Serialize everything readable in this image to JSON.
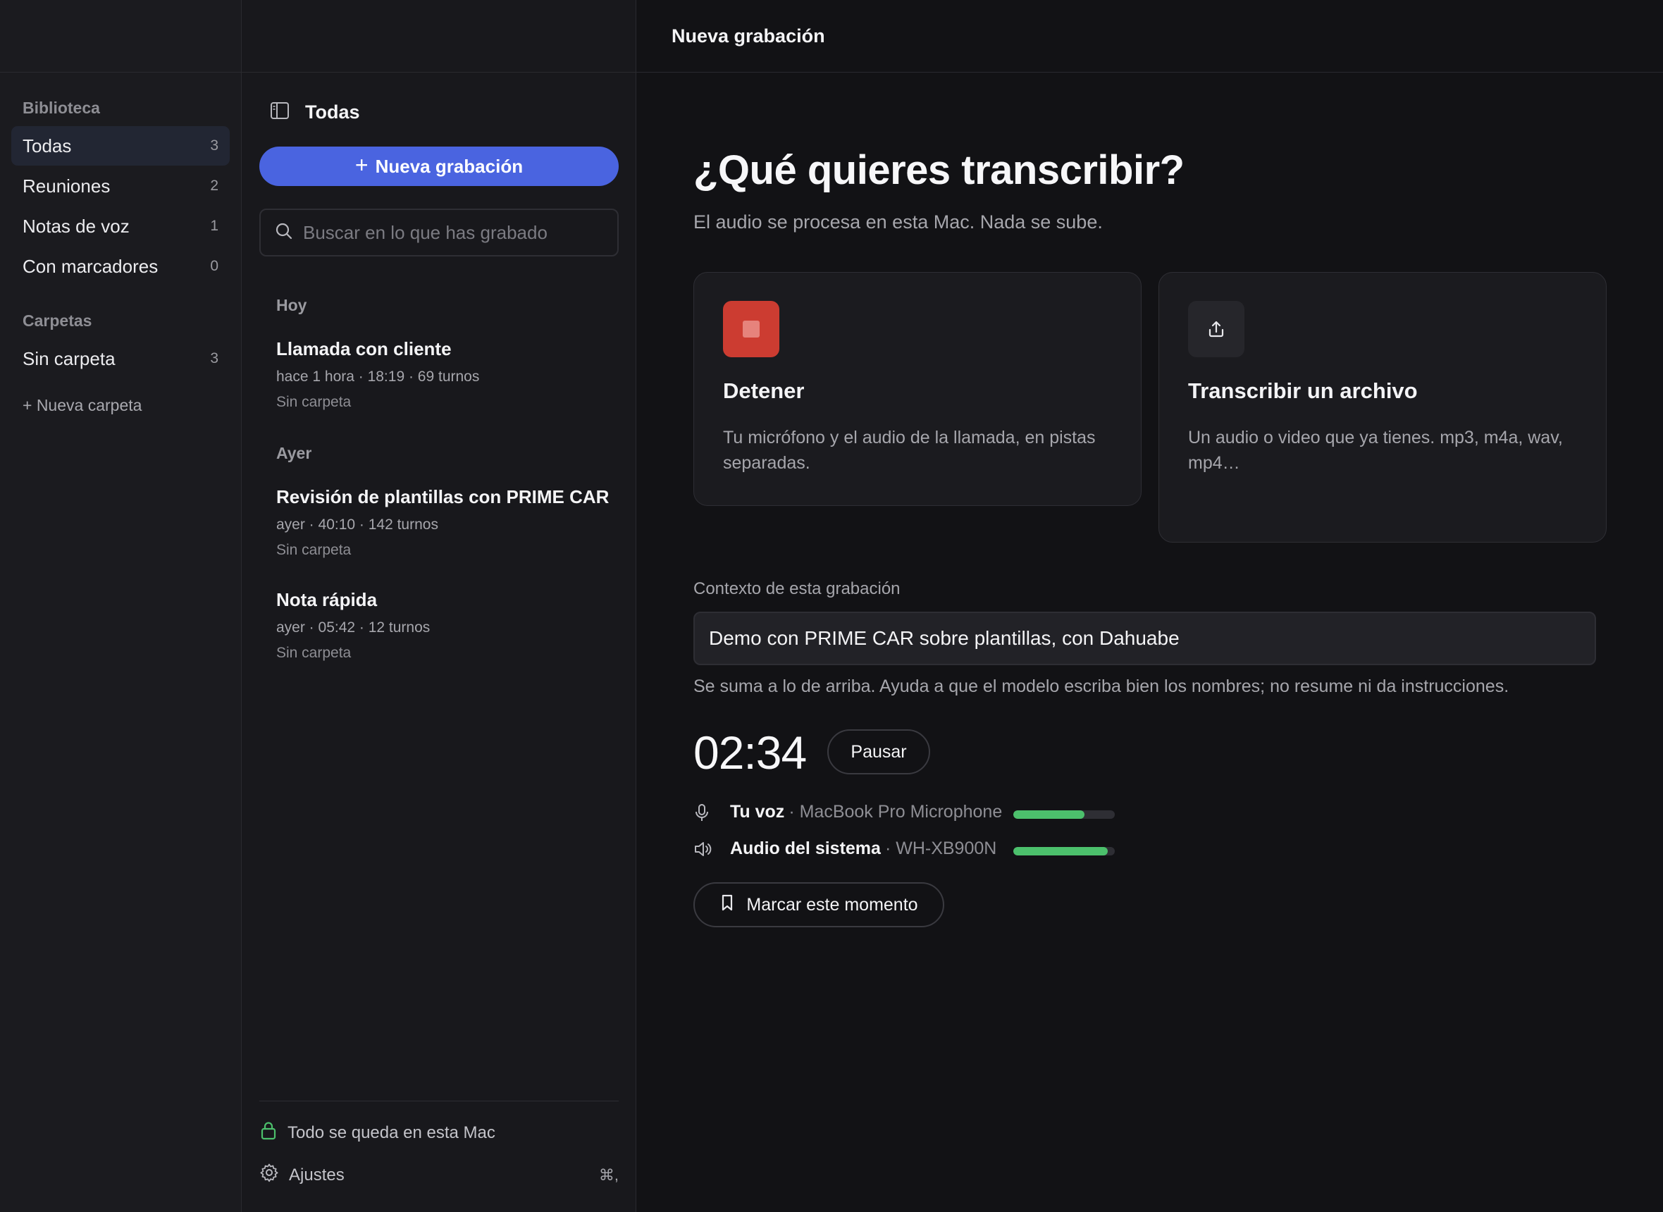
{
  "sidebar": {
    "library_title": "Biblioteca",
    "items": [
      {
        "label": "Todas",
        "count": "3"
      },
      {
        "label": "Reuniones",
        "count": "2"
      },
      {
        "label": "Notas de voz",
        "count": "1"
      },
      {
        "label": "Con marcadores",
        "count": "0"
      }
    ],
    "folders_title": "Carpetas",
    "folders": [
      {
        "label": "Sin carpeta",
        "count": "3"
      }
    ],
    "new_folder": "+ Nueva carpeta"
  },
  "list": {
    "title": "Todas",
    "new_button": "Nueva grabación",
    "search_placeholder": "Buscar en lo que has grabado",
    "groups": [
      {
        "label": "Hoy"
      },
      {
        "label": "Ayer"
      }
    ],
    "recordings": [
      {
        "title": "Llamada con cliente",
        "meta": "hace 1 hora · 18:19 · 69 turnos",
        "folder": "Sin carpeta"
      },
      {
        "title": "Revisión de plantillas con PRIME CAR",
        "meta": "ayer · 40:10 · 142 turnos",
        "folder": "Sin carpeta"
      },
      {
        "title": "Nota rápida",
        "meta": "ayer · 05:42 · 12 turnos",
        "folder": "Sin carpeta"
      }
    ],
    "privacy": "Todo se queda en esta Mac",
    "settings": "Ajustes",
    "settings_shortcut": "⌘,"
  },
  "main": {
    "top_title": "Nueva grabación",
    "hero_title": "¿Qué quieres transcribir?",
    "hero_subtitle": "El audio se procesa en esta Mac. Nada se sube.",
    "cards": [
      {
        "title": "Detener",
        "description": "Tu micrófono y el audio de la llamada, en pistas separadas."
      },
      {
        "title": "Transcribir un archivo",
        "description": "Un audio o video que ya tienes. mp3, m4a, wav, mp4…"
      }
    ],
    "context_label": "Contexto de esta grabación",
    "context_value": "Demo con PRIME CAR sobre plantillas, con Dahuabe",
    "context_help": "Se suma a lo de arriba. Ayuda a que el modelo escriba bien los nombres; no resume ni da instrucciones.",
    "timer": "02:34",
    "pause_label": "Pausar",
    "sources": [
      {
        "name": "Tu voz",
        "device": "· MacBook Pro Microphone",
        "level": 0.7
      },
      {
        "name": "Audio del sistema",
        "device": "· WH-XB900N",
        "level": 0.93
      }
    ],
    "mark_label": "Marcar este momento"
  },
  "colors": {
    "accent": "#4a64e0",
    "stop": "#cc3c31",
    "meter": "#4cc06c",
    "lock": "#4cc06c"
  }
}
